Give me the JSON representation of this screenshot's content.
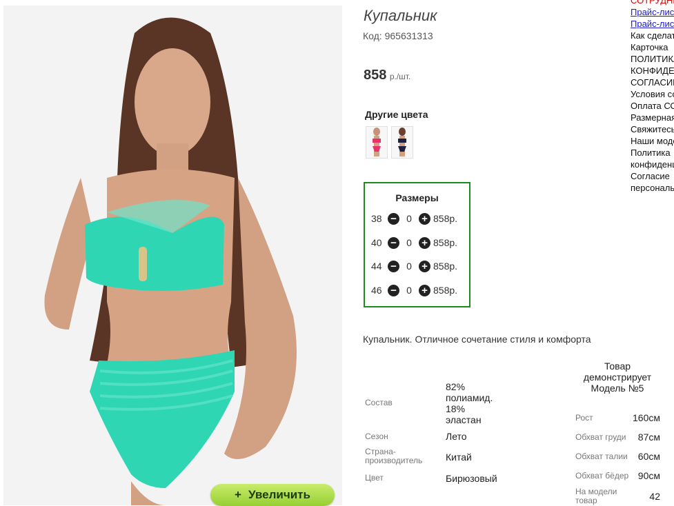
{
  "product": {
    "title": "Купальник",
    "code": "Код: 965631313",
    "price": "858",
    "price_unit": "р./шт.",
    "zoom_label": "Увеличить",
    "zoom_plus": "+"
  },
  "colors": {
    "heading": "Другие цвета",
    "swatches": [
      {
        "name": "pink",
        "color": "#e8326a"
      },
      {
        "name": "navy",
        "color": "#1e2040"
      }
    ]
  },
  "sizes": {
    "heading": "Размеры",
    "rows": [
      {
        "size": "38",
        "qty": "0",
        "price": "858р."
      },
      {
        "size": "40",
        "qty": "0",
        "price": "858р."
      },
      {
        "size": "44",
        "qty": "0",
        "price": "858р."
      },
      {
        "size": "46",
        "qty": "0",
        "price": "858р."
      }
    ]
  },
  "description": "Купальник. Отличное сочетание стиля и комфорта",
  "attributes": [
    {
      "label": "Состав",
      "value_lines": [
        "82%",
        "полиамид.",
        "18%",
        "эластан"
      ]
    },
    {
      "label": "Сезон",
      "value_lines": [
        "Лето"
      ]
    },
    {
      "label_lines": [
        "Страна-",
        "производитель"
      ],
      "value_lines": [
        "Китай"
      ]
    },
    {
      "label": "Цвет",
      "value_lines": [
        "Бирюзовый"
      ]
    }
  ],
  "model": {
    "heading_lines": [
      "Товар",
      "демонстрирует",
      "Модель №5"
    ],
    "rows": [
      {
        "label": "Рост",
        "value": "160см"
      },
      {
        "label": "Обхват груди",
        "value": "87см"
      },
      {
        "label": "Обхват талии",
        "value": "60см"
      },
      {
        "label": "Обхват бёдер",
        "value": "90см"
      },
      {
        "label_lines": [
          "На модели",
          "товар"
        ],
        "value": "42"
      }
    ]
  },
  "menu": [
    {
      "text": "СОТРУДНИЧЕСТВО",
      "color": "#e00000"
    },
    {
      "text": "Прайс-лист",
      "color": "#1a1ad6"
    },
    {
      "text": "Прайс-лист",
      "color": "#1a1ad6"
    },
    {
      "text": "Как сделать заказ",
      "color": "#111111"
    },
    {
      "text": "Карточка",
      "color": "#111111"
    },
    {
      "text": "ПОЛИТИКА",
      "color": "#111111"
    },
    {
      "text": "КОНФИДЕНЦИАЛЬНОСТИ",
      "color": "#111111"
    },
    {
      "text": "СОГЛАСИЕ",
      "color": "#111111"
    },
    {
      "text": "Условия сотрудничества",
      "color": "#111111"
    },
    {
      "text": "Оплата СОД",
      "color": "#111111"
    },
    {
      "text": "Размерная сетка",
      "color": "#111111"
    },
    {
      "text": "Свяжитесь с нами",
      "color": "#111111"
    },
    {
      "text": "Наши модели",
      "color": "#111111"
    },
    {
      "text": "Политика",
      "color": "#111111"
    },
    {
      "text": "конфиденциальности",
      "color": "#111111"
    },
    {
      "text": "Согласие",
      "color": "#111111"
    },
    {
      "text": "персональных",
      "color": "#111111"
    }
  ]
}
